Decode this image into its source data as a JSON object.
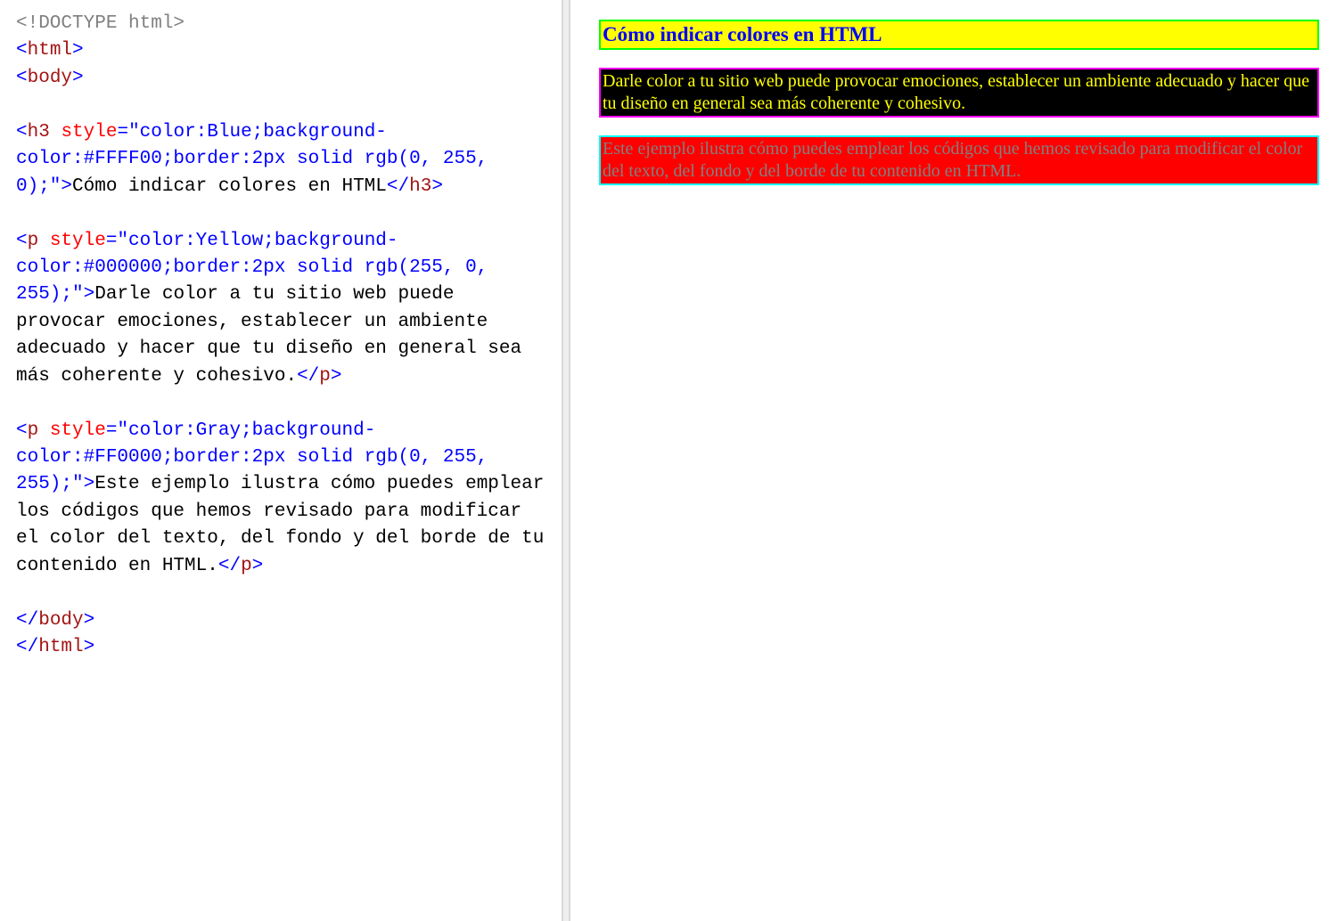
{
  "code": {
    "lines": [
      [
        {
          "t": "<!DOCTYPE html>",
          "c": "tok-doctype"
        }
      ],
      [
        {
          "t": "<",
          "c": "tok-angle"
        },
        {
          "t": "html",
          "c": "tok-tag"
        },
        {
          "t": ">",
          "c": "tok-angle"
        }
      ],
      [
        {
          "t": "<",
          "c": "tok-angle"
        },
        {
          "t": "body",
          "c": "tok-tag"
        },
        {
          "t": ">",
          "c": "tok-angle"
        }
      ],
      [],
      [
        {
          "t": "<",
          "c": "tok-angle"
        },
        {
          "t": "h3",
          "c": "tok-tag"
        },
        {
          "t": " ",
          "c": "tok-text"
        },
        {
          "t": "style",
          "c": "tok-attr"
        },
        {
          "t": "=",
          "c": "tok-angle"
        },
        {
          "t": "\"color:Blue;background-color:#FFFF00;border:2px solid rgb(0, 255, 0);\"",
          "c": "tok-val"
        },
        {
          "t": ">",
          "c": "tok-angle"
        },
        {
          "t": "Cómo indicar colores en HTML",
          "c": "tok-text"
        },
        {
          "t": "<",
          "c": "tok-angle"
        },
        {
          "t": "/",
          "c": "tok-slash"
        },
        {
          "t": "h3",
          "c": "tok-tag"
        },
        {
          "t": ">",
          "c": "tok-angle"
        }
      ],
      [],
      [
        {
          "t": "<",
          "c": "tok-angle"
        },
        {
          "t": "p",
          "c": "tok-tag"
        },
        {
          "t": " ",
          "c": "tok-text"
        },
        {
          "t": "style",
          "c": "tok-attr"
        },
        {
          "t": "=",
          "c": "tok-angle"
        },
        {
          "t": "\"color:Yellow;background-color:#000000;border:2px solid rgb(255, 0, 255);\"",
          "c": "tok-val"
        },
        {
          "t": ">",
          "c": "tok-angle"
        },
        {
          "t": "Darle color a tu sitio web puede provocar emociones, establecer un ambiente adecuado y hacer que tu diseño en general sea más coherente y cohesivo.",
          "c": "tok-text"
        },
        {
          "t": "<",
          "c": "tok-angle"
        },
        {
          "t": "/",
          "c": "tok-slash"
        },
        {
          "t": "p",
          "c": "tok-tag"
        },
        {
          "t": ">",
          "c": "tok-angle"
        }
      ],
      [],
      [
        {
          "t": "<",
          "c": "tok-angle"
        },
        {
          "t": "p",
          "c": "tok-tag"
        },
        {
          "t": " ",
          "c": "tok-text"
        },
        {
          "t": "style",
          "c": "tok-attr"
        },
        {
          "t": "=",
          "c": "tok-angle"
        },
        {
          "t": "\"color:Gray;background-color:#FF0000;border:2px solid rgb(0, 255, 255);\"",
          "c": "tok-val"
        },
        {
          "t": ">",
          "c": "tok-angle"
        },
        {
          "t": "Este ejemplo ilustra cómo puedes emplear los códigos que hemos revisado para modificar el color del texto, del fondo y del borde de tu contenido en HTML.",
          "c": "tok-text"
        },
        {
          "t": "<",
          "c": "tok-angle"
        },
        {
          "t": "/",
          "c": "tok-slash"
        },
        {
          "t": "p",
          "c": "tok-tag"
        },
        {
          "t": ">",
          "c": "tok-angle"
        }
      ],
      [],
      [
        {
          "t": "<",
          "c": "tok-angle"
        },
        {
          "t": "/",
          "c": "tok-slash"
        },
        {
          "t": "body",
          "c": "tok-tag"
        },
        {
          "t": ">",
          "c": "tok-angle"
        }
      ],
      [
        {
          "t": "<",
          "c": "tok-angle"
        },
        {
          "t": "/",
          "c": "tok-slash"
        },
        {
          "t": "html",
          "c": "tok-tag"
        },
        {
          "t": ">",
          "c": "tok-angle"
        }
      ]
    ]
  },
  "preview": {
    "heading": {
      "text": "Cómo indicar colores en HTML",
      "color": "Blue",
      "background": "#FFFF00",
      "border": "2px solid rgb(0, 255, 0)"
    },
    "para1": {
      "text": "Darle color a tu sitio web puede provocar emociones, establecer un ambiente adecuado y hacer que tu diseño en general sea más coherente y cohesivo.",
      "color": "Yellow",
      "background": "#000000",
      "border": "2px solid rgb(255, 0, 255)"
    },
    "para2": {
      "text": "Este ejemplo ilustra cómo puedes emplear los códigos que hemos revisado para modificar el color del texto, del fondo y del borde de tu contenido en HTML.",
      "color": "Gray",
      "background": "#FF0000",
      "border": "2px solid rgb(0, 255, 255)"
    }
  }
}
